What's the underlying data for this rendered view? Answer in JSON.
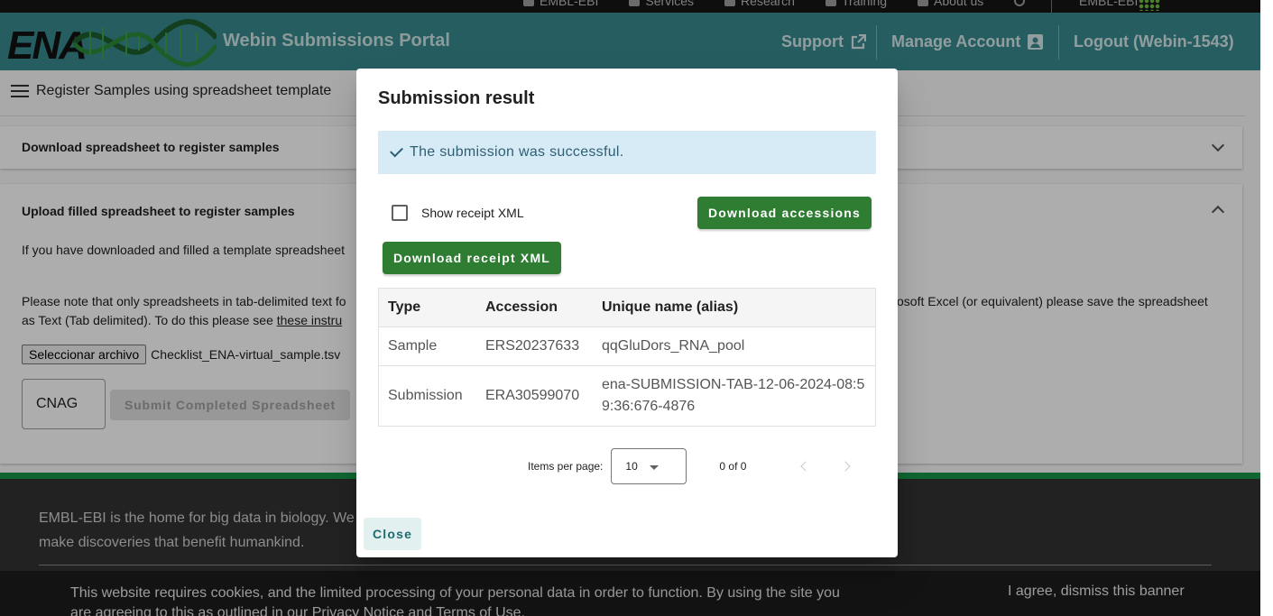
{
  "top_strip": {
    "nav": [
      "EMBL-EBI",
      "Services",
      "Research",
      "Training",
      "About us"
    ],
    "org": "EMBL-EBI"
  },
  "header": {
    "logo_text": "ENA",
    "portal_title": "Webin Submissions Portal",
    "support": "Support",
    "manage_account": "Manage Account",
    "logout": "Logout (Webin-1543)"
  },
  "page": {
    "title": "Register Samples using spreadsheet template",
    "panel1_title": "Download spreadsheet to register samples",
    "panel2_title": "Upload filled spreadsheet to register samples",
    "upload_intro": "If you have downloaded and filled a template spreadsheet",
    "note_line1_left": "Please note that only spreadsheets in tab-delimited text fo",
    "note_line1_right": "osoft Excel (or equivalent) please save the spreadsheet",
    "note_line2_prefix": "as Text (Tab delimited). To do this please see",
    "note_line2_link": "these instru",
    "file_button": "Seleccionar archivo",
    "file_name": "Checklist_ENA-virtual_sample.tsv",
    "center_value": "CNAG",
    "submit_button": "Submit Completed Spreadsheet"
  },
  "footer": {
    "text": "EMBL-EBI is the home for big data in biology. We make discoveries that benefit humankind."
  },
  "cookie": {
    "text": "This website requires cookies, and the limited processing of your personal data in order to function. By using the site you are agreeing to this as outlined in our Privacy Notice and Terms of Use.",
    "agree": "I agree, dismiss this banner"
  },
  "dialog": {
    "title": "Submission result",
    "alert": "The submission was successful.",
    "show_receipt_label": "Show receipt XML",
    "download_accessions": "Download accessions",
    "download_receipt": "Download receipt XML",
    "table": {
      "headers": [
        "Type",
        "Accession",
        "Unique name (alias)"
      ],
      "rows": [
        {
          "type": "Sample",
          "accession": "ERS20237633",
          "alias": "qqGluDors_RNA_pool"
        },
        {
          "type": "Submission",
          "accession": "ERA30599070",
          "alias": "ena-SUBMISSION-TAB-12-06-2024-08:59:36:676-4876"
        }
      ]
    },
    "paginator": {
      "items_per_page_label": "Items per page:",
      "items_per_page_value": "10",
      "range": "0 of 0"
    },
    "close": "Close"
  },
  "colors": {
    "header": "#37898e",
    "primary_button": "#2e7d32",
    "alert_bg": "#d6ebf5",
    "footer_accent": "#18974c"
  }
}
